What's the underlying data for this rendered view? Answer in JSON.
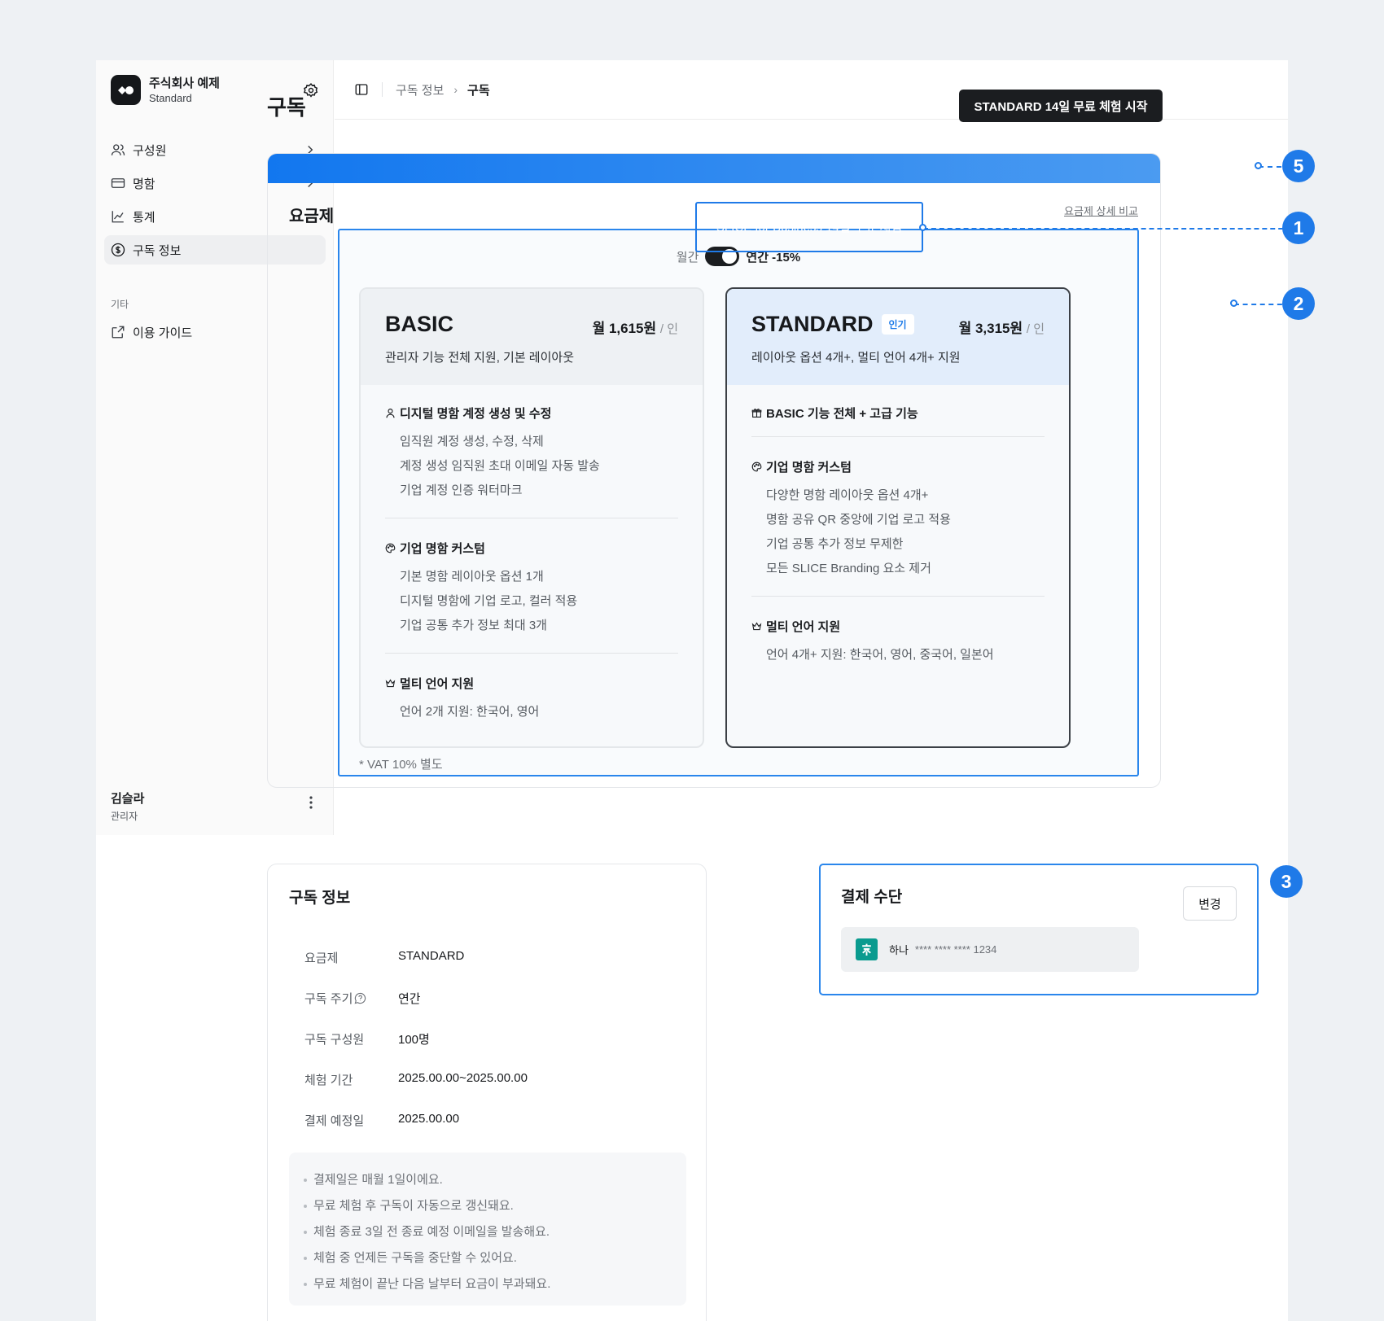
{
  "sidebar": {
    "company": "주식회사 예제",
    "plan": "Standard",
    "items": [
      {
        "label": "구성원"
      },
      {
        "label": "명함"
      },
      {
        "label": "통계"
      },
      {
        "label": "구독 정보"
      }
    ],
    "section_label": "기타",
    "guide": "이용 가이드",
    "user_name": "김슬라",
    "user_role": "관리자"
  },
  "breadcrumb": {
    "parent": "구독 정보",
    "current": "구독"
  },
  "page_title": "구독",
  "trial_button": "STANDARD 14일 무료 체험 시작",
  "banner": "SLICE for Business 14일 무료 체험",
  "plans": {
    "heading": "요금제",
    "compare_link": "요금제 상세 비교",
    "billing_monthly": "월간",
    "billing_yearly": "연간 -15%",
    "billing_yearly_selected": true,
    "basic": {
      "name": "BASIC",
      "price": "월 1,615원",
      "unit": "/ 인",
      "desc": "관리자 기능 전체 지원, 기본 레이아웃",
      "groups": [
        {
          "icon": "person-icon",
          "title": "디지털 명함 계정 생성 및 수정",
          "items": [
            "임직원 계정 생성, 수정, 삭제",
            "계정 생성 임직원 초대 이메일 자동 발송",
            "기업 계정 인증 워터마크"
          ]
        },
        {
          "icon": "palette-icon",
          "title": "기업 명함 커스텀",
          "items": [
            "기본 명함 레이아웃 옵션 1개",
            "디지털 명함에 기업 로고, 컬러 적용",
            "기업 공통 추가 정보 최대 3개"
          ]
        },
        {
          "icon": "crown-icon",
          "title": "멀티 언어 지원",
          "items": [
            "언어 2개 지원: 한국어, 영어"
          ]
        }
      ]
    },
    "standard": {
      "name": "STANDARD",
      "badge": "인기",
      "price": "월 3,315원",
      "unit": "/ 인",
      "desc": "레이아웃 옵션 4개+, 멀티 언어 4개+ 지원",
      "groups": [
        {
          "icon": "gift-icon",
          "title": "BASIC 기능 전체 + 고급 기능",
          "items": []
        },
        {
          "icon": "palette-icon",
          "title": "기업 명함 커스텀",
          "items": [
            "다양한 명함 레이아웃 옵션 4개+",
            "명함 공유 QR 중앙에 기업 로고 적용",
            "기업 공통 추가 정보 무제한",
            "모든 SLICE Branding 요소 제거"
          ]
        },
        {
          "icon": "crown-icon",
          "title": "멀티 언어 지원",
          "items": [
            "언어 4개+ 지원: 한국어, 영어, 중국어, 일본어"
          ]
        }
      ]
    },
    "vat": "* VAT 10% 별도"
  },
  "subscription": {
    "title": "구독 정보",
    "rows": [
      {
        "key": "요금제",
        "value": "STANDARD"
      },
      {
        "key": "구독 주기",
        "value": "연간"
      },
      {
        "key": "구독 구성원",
        "value": "100명"
      },
      {
        "key": "체험 기간",
        "value": "2025.00.00~2025.00.00"
      },
      {
        "key": "결제 예정일",
        "value": "2025.00.00"
      }
    ],
    "notes": [
      "결제일은 매월 1일이에요.",
      "무료 체험 후 구독이 자동으로 갱신돼요.",
      "체험 종료 3일 전 종료 예정 이메일을 발송해요.",
      "체험 중 언제든 구독을 중단할 수 있어요.",
      "무료 체험이 끝난 다음 날부터 요금이 부과돼요."
    ]
  },
  "payment": {
    "title": "결제 수단",
    "change": "변경",
    "bank": "하나",
    "number": "**** **** **** 1234"
  },
  "callouts": {
    "c1": "1",
    "c2": "2",
    "c3": "3",
    "c5": "5"
  },
  "colors": {
    "accent": "#1f7ae8",
    "dark": "#1b1d20",
    "bank": "#0a9b8f"
  }
}
